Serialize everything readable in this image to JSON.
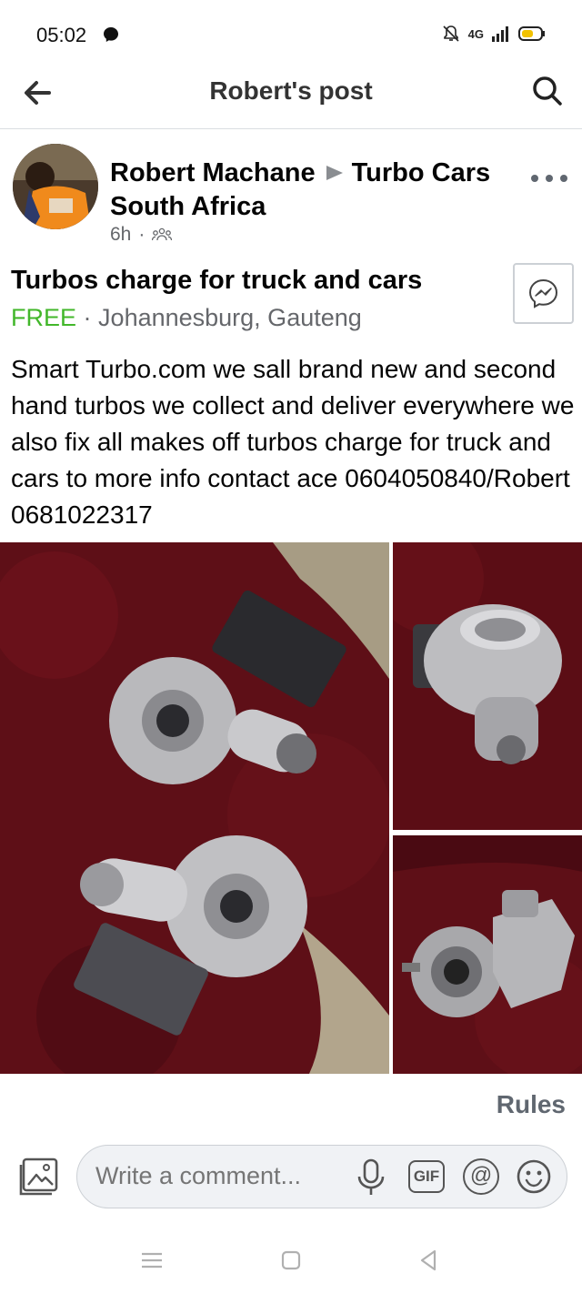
{
  "status_bar": {
    "time": "05:02",
    "network": "4G",
    "icons": [
      "messenger-icon",
      "mute-bell-icon",
      "signal-icon",
      "battery-icon"
    ]
  },
  "header": {
    "title": "Robert's post",
    "back_icon": "back-arrow-icon",
    "search_icon": "search-icon"
  },
  "post": {
    "author": "Robert Machane",
    "group_name_line1": "Turbo Cars",
    "group_name_line2": "South Africa",
    "time": "6h",
    "separator": "·",
    "audience_icon": "group-members-icon",
    "listing": {
      "title": "Turbos charge for truck and cars",
      "price": "FREE",
      "separator": "·",
      "location": "Johannesburg, Gauteng"
    },
    "body": "Smart Turbo.com we sall brand new and second hand turbos we collect and deliver everywhere we also fix all makes off turbos charge for truck and cars to more info contact ace 0604050840/Robert 0681022317",
    "photos": [
      "turbo-pair-photo",
      "turbo-top-photo",
      "turbo-side-photo"
    ]
  },
  "rules_label": "Rules",
  "comment_bar": {
    "placeholder": "Write a comment...",
    "gif_label": "GIF",
    "mention_label": "@",
    "icons": [
      "photo-attach-icon",
      "microphone-icon",
      "gif-icon",
      "mention-icon",
      "emoji-icon"
    ]
  },
  "colors": {
    "price_green": "#42b72a",
    "secondary_text": "#65676b",
    "divider": "#dadde1",
    "comment_bg": "#f0f2f5"
  }
}
